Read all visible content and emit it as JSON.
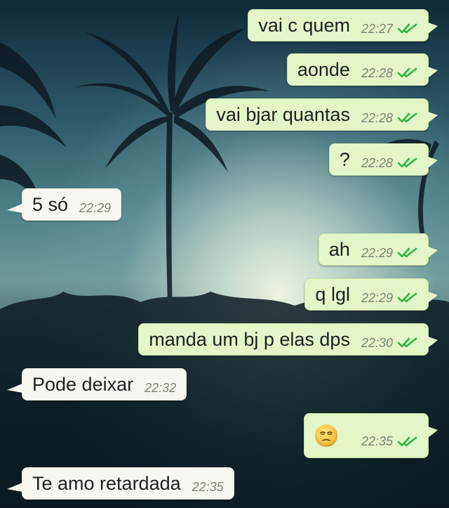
{
  "messages": [
    {
      "id": "m1",
      "dir": "out",
      "text": "vai c quem",
      "time": "22:27",
      "ticks": "double-check-icon"
    },
    {
      "id": "m2",
      "dir": "out",
      "text": "aonde",
      "time": "22:28",
      "ticks": "double-check-icon"
    },
    {
      "id": "m3",
      "dir": "out",
      "text": "vai bjar quantas",
      "time": "22:28",
      "ticks": "double-check-icon"
    },
    {
      "id": "m4",
      "dir": "out",
      "text": "?",
      "time": "22:28",
      "ticks": "double-check-icon"
    },
    {
      "id": "m5",
      "dir": "in",
      "text": "5 só",
      "time": "22:29"
    },
    {
      "id": "m6",
      "dir": "out",
      "text": "ah",
      "time": "22:29",
      "ticks": "double-check-icon"
    },
    {
      "id": "m7",
      "dir": "out",
      "text": "q lgl",
      "time": "22:29",
      "ticks": "double-check-icon"
    },
    {
      "id": "m8",
      "dir": "out",
      "text": "manda um bj p elas dps",
      "time": "22:30",
      "ticks": "double-check-icon"
    },
    {
      "id": "m9",
      "dir": "in",
      "text": "Pode deixar",
      "time": "22:32"
    },
    {
      "id": "m10",
      "dir": "out",
      "emoji": "unamused-face-icon",
      "time": "22:35",
      "ticks": "double-check-icon"
    },
    {
      "id": "m11",
      "dir": "in",
      "text": "Te amo retardada",
      "time": "22:35"
    }
  ],
  "colors": {
    "outgoing_bubble": "#e2f6c8",
    "incoming_bubble": "#f7f7f2",
    "tick_green": "#2fb34a",
    "time_gray": "#7a8573"
  }
}
